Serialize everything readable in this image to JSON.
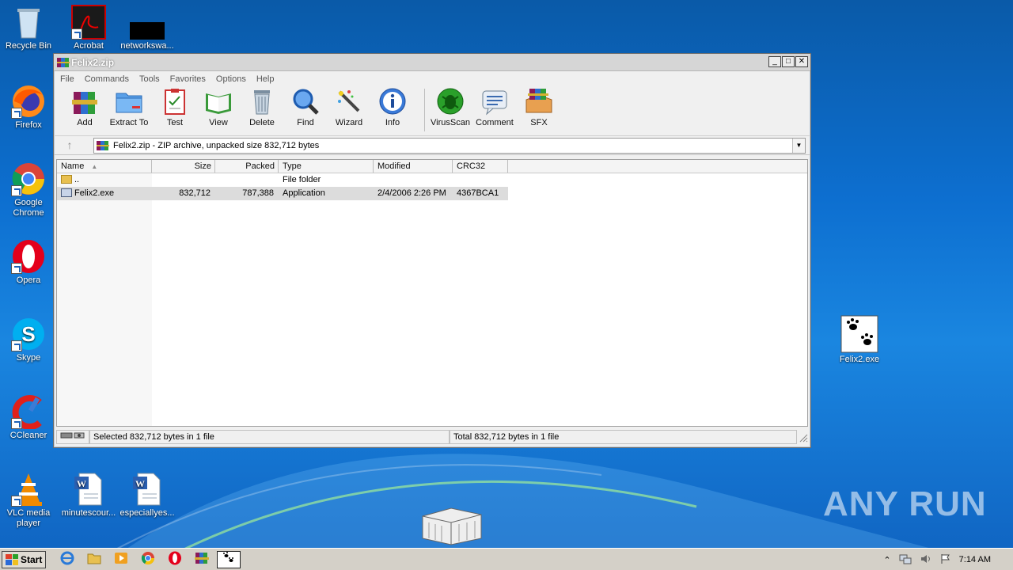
{
  "desktop": {
    "icons": [
      {
        "id": "recycle",
        "label": "Recycle Bin"
      },
      {
        "id": "acrobat",
        "label": "Acrobat"
      },
      {
        "id": "network",
        "label": "networkswa..."
      },
      {
        "id": "firefox",
        "label": "Firefox"
      },
      {
        "id": "chrome",
        "label": "Google Chrome"
      },
      {
        "id": "opera",
        "label": "Opera"
      },
      {
        "id": "skype",
        "label": "Skype"
      },
      {
        "id": "ccleaner",
        "label": "CCleaner"
      },
      {
        "id": "vlc",
        "label": "VLC media player"
      },
      {
        "id": "minutes",
        "label": "minutescour..."
      },
      {
        "id": "especially",
        "label": "especiallyes..."
      },
      {
        "id": "felix",
        "label": "Felix2.exe"
      }
    ],
    "watermark": "ANY RUN"
  },
  "window": {
    "title": "Felix2.zip",
    "menu": [
      "File",
      "Commands",
      "Tools",
      "Favorites",
      "Options",
      "Help"
    ],
    "toolbar": [
      "Add",
      "Extract To",
      "Test",
      "View",
      "Delete",
      "Find",
      "Wizard",
      "Info",
      "VirusScan",
      "Comment",
      "SFX"
    ],
    "address": "Felix2.zip - ZIP archive, unpacked size 832,712 bytes",
    "columns": [
      "Name",
      "Size",
      "Packed",
      "Type",
      "Modified",
      "CRC32"
    ],
    "rows": [
      {
        "name": "..",
        "size": "",
        "packed": "",
        "type": "File folder",
        "modified": "",
        "crc": ""
      },
      {
        "name": "Felix2.exe",
        "size": "832,712",
        "packed": "787,388",
        "type": "Application",
        "modified": "2/4/2006 2:26 PM",
        "crc": "4367BCA1"
      }
    ],
    "status_left": "Selected 832,712 bytes in 1 file",
    "status_right": "Total 832,712 bytes in 1 file"
  },
  "taskbar": {
    "start_label": "Start",
    "clock": "7:14 AM"
  }
}
